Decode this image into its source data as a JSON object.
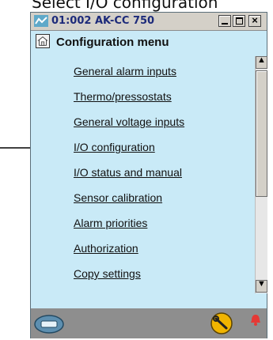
{
  "instruction": "Select I/O configuration",
  "window": {
    "title": "01:002 AK-CC 750",
    "buttons": {
      "minimize": "_",
      "maximize": "□",
      "close": "×"
    }
  },
  "header": {
    "title": "Configuration menu"
  },
  "menu": {
    "items": [
      {
        "label": "General alarm inputs"
      },
      {
        "label": "Thermo/pressostats"
      },
      {
        "label": "General voltage inputs"
      },
      {
        "label": "I/O configuration"
      },
      {
        "label": "I/O status and manual"
      },
      {
        "label": "Sensor calibration"
      },
      {
        "label": "Alarm priorities"
      },
      {
        "label": "Authorization"
      },
      {
        "label": "Copy settings"
      }
    ]
  },
  "scrollbar": {
    "up": "▲",
    "down": "▼"
  },
  "colors": {
    "window_bg": "#c9eaf7",
    "titlebar_bg": "#d4d0c8",
    "footer_bg": "#8e8e8e",
    "alarm": "#e53935"
  },
  "icons": {
    "app": "app-icon",
    "home": "home-icon",
    "footer_left": "device-icon",
    "footer_tool": "wrench-icon",
    "footer_alarm": "alarm-bell-icon"
  }
}
